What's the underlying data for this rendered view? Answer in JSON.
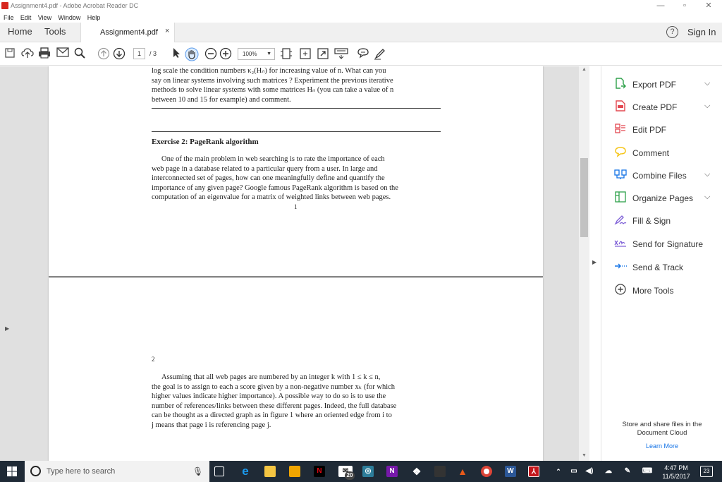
{
  "window": {
    "title": "Assignment4.pdf - Adobe Acrobat Reader DC",
    "minimize": "—",
    "maximize": "▫",
    "close": "✕"
  },
  "menu": [
    "File",
    "Edit",
    "View",
    "Window",
    "Help"
  ],
  "tabs": {
    "home": "Home",
    "tools": "Tools",
    "document": "Assignment4.pdf",
    "close": "×",
    "help": "?",
    "signin": "Sign In"
  },
  "toolbar": {
    "page_current": "1",
    "page_total": "/ 3",
    "zoom": "100%",
    "icons": [
      "save-icon",
      "upload-icon",
      "print-icon",
      "email-icon",
      "search-icon",
      "page-up-icon",
      "page-down-icon",
      "select-pointer-icon",
      "hand-tool-icon",
      "zoom-out-icon",
      "zoom-in-icon",
      "fit-page-icon",
      "read-mode-icon",
      "full-screen-icon",
      "keyboard-icon",
      "comment-icon",
      "sign-icon"
    ]
  },
  "document": {
    "page1": {
      "intro_lines": [
        "log scale the condition numbers κ₂(Hₙ) for increasing value of n. What can you",
        "say on linear systems involving such matrices ? Experiment the previous iterative",
        "methods to solve linear systems with some matrices Hₙ (you can take a value of n",
        "between 10 and 15 for example) and comment."
      ],
      "exercise_title": "Exercise 2: PageRank algorithm",
      "exercise_lines": [
        "One of the main problem in web searching is to rate the importance of each",
        "web page in a database related to a particular query from a user. In large and",
        "interconnected set of pages, how can one meaningfully define and quantify the",
        "importance of any given page? Google famous PageRank algorithm is based on the",
        "computation of an eigenvalue for a matrix of weighted links between web pages."
      ],
      "page_number": "1"
    },
    "page2": {
      "page_number": "2",
      "lines": [
        "Assuming that all web pages are numbered by an integer k with 1 ≤ k ≤ n,",
        "the goal is to assign to each a score given by a non-negative number xₖ (for which",
        "higher values indicate higher importance). A possible way to do so is to use the",
        "number of references/links between these different pages. Indeed, the full database",
        "can be thought as a directed graph as in figure 1 where an oriented edge from i to",
        "j means that page i is referencing page j."
      ]
    }
  },
  "tools_pane": {
    "items": [
      {
        "label": "Export PDF",
        "icon": "export-pdf-icon",
        "color": "#2ea14a",
        "chevron": true
      },
      {
        "label": "Create PDF",
        "icon": "create-pdf-icon",
        "color": "#e34850",
        "chevron": true
      },
      {
        "label": "Edit PDF",
        "icon": "edit-pdf-icon",
        "color": "#e34850",
        "chevron": false
      },
      {
        "label": "Comment",
        "icon": "comment-icon",
        "color": "#f5c518",
        "chevron": false
      },
      {
        "label": "Combine Files",
        "icon": "combine-files-icon",
        "color": "#1473e6",
        "chevron": true
      },
      {
        "label": "Organize Pages",
        "icon": "organize-pages-icon",
        "color": "#2ea14a",
        "chevron": true
      },
      {
        "label": "Fill & Sign",
        "icon": "fill-sign-icon",
        "color": "#7b5cd6",
        "chevron": false
      },
      {
        "label": "Send for Signature",
        "icon": "send-signature-icon",
        "color": "#7b5cd6",
        "chevron": false
      },
      {
        "label": "Send & Track",
        "icon": "send-track-icon",
        "color": "#1473e6",
        "chevron": false
      },
      {
        "label": "More Tools",
        "icon": "more-tools-icon",
        "color": "#444444",
        "chevron": false
      }
    ],
    "footer": "Store and share files in the Document Cloud",
    "learn_more": "Learn More"
  },
  "taskbar": {
    "search_placeholder": "Type here to search",
    "time": "4:47 PM",
    "date": "11/5/2017",
    "notifications": "23",
    "mail_badge": "20"
  }
}
